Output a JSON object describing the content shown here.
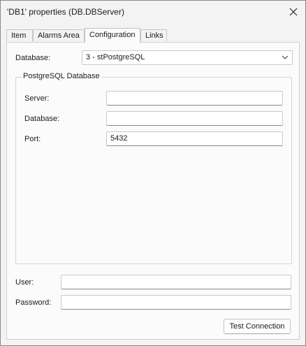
{
  "window": {
    "title": "'DB1' properties (DB.DBServer)",
    "close_icon": "close-icon"
  },
  "tabs": [
    {
      "label": "Item",
      "active": false
    },
    {
      "label": "Alarms Area",
      "active": false
    },
    {
      "label": "Configuration",
      "active": true
    },
    {
      "label": "Links",
      "active": false
    }
  ],
  "config": {
    "database_label": "Database:",
    "database_value": "3 - stPostgreSQL",
    "group_title": "PostgreSQL Database",
    "server_label": "Server:",
    "server_value": "",
    "db_label": "Database:",
    "db_value": "",
    "port_label": "Port:",
    "port_value": "5432",
    "user_label": "User:",
    "user_value": "",
    "password_label": "Password:",
    "password_value": "",
    "test_button": "Test Connection"
  }
}
